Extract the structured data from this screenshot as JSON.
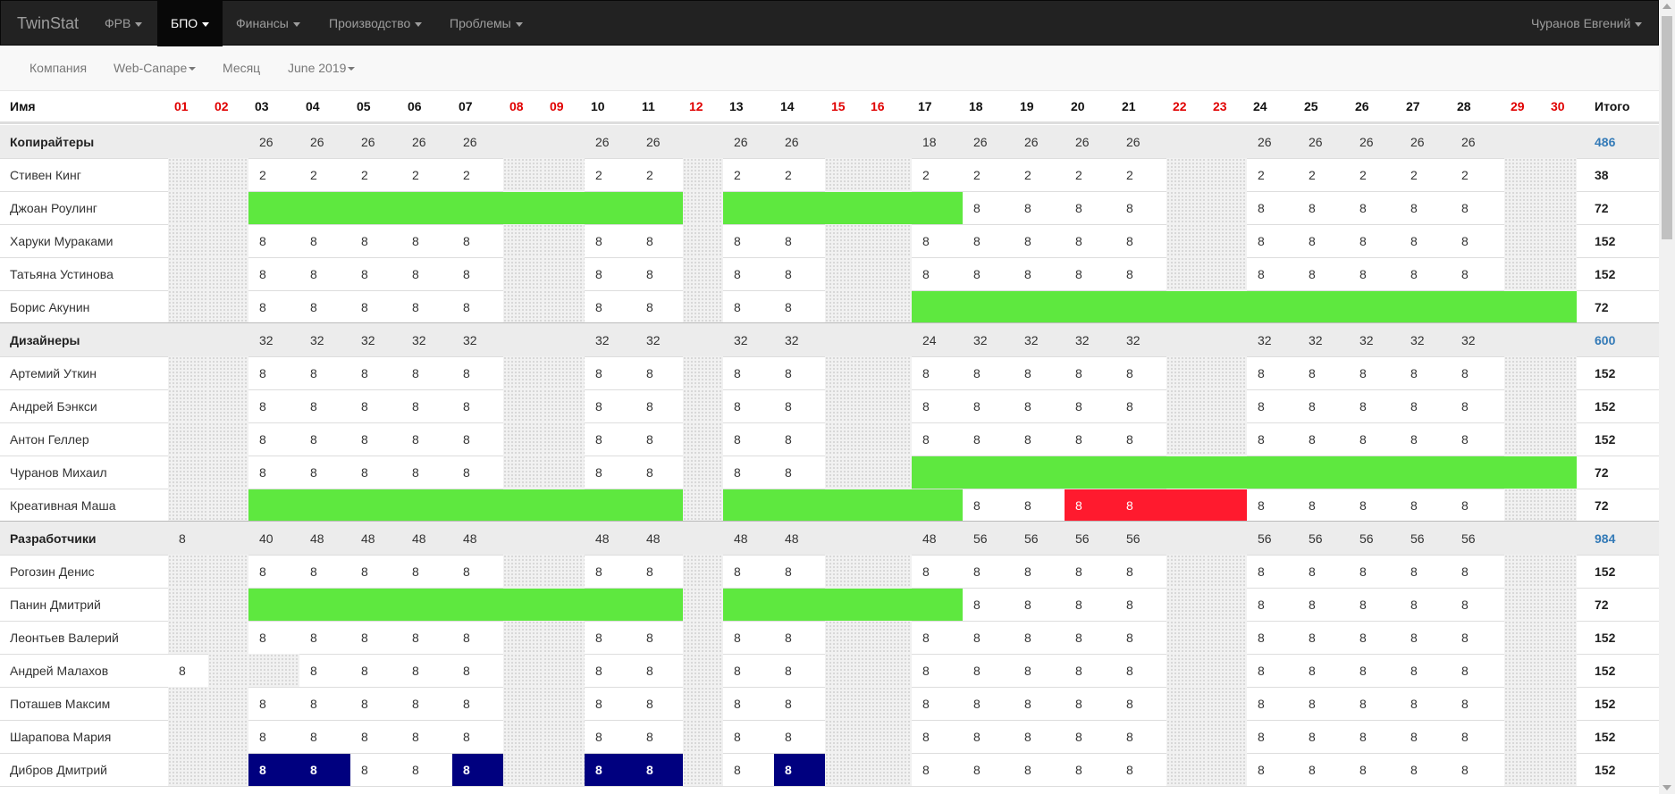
{
  "navbar": {
    "brand": "TwinStat",
    "items": [
      {
        "label": "ФРВ",
        "active": false
      },
      {
        "label": "БПО",
        "active": true
      },
      {
        "label": "Финансы",
        "active": false
      },
      {
        "label": "Производство",
        "active": false
      },
      {
        "label": "Проблемы",
        "active": false
      }
    ],
    "user": "Чуранов Евгений"
  },
  "subnav": {
    "company": "Компания",
    "project": "Web-Canape",
    "period": "Месяц",
    "month": "June 2019"
  },
  "colors": {
    "vacation": "#5ee83f",
    "absent": "#ff1a2e",
    "overtime": "#00007f",
    "weekend_text": "#e00000",
    "total_link": "#337ab7"
  },
  "table": {
    "name_header": "Имя",
    "total_header": "Итого",
    "days": [
      "01",
      "02",
      "03",
      "04",
      "05",
      "06",
      "07",
      "08",
      "09",
      "10",
      "11",
      "12",
      "13",
      "14",
      "15",
      "16",
      "17",
      "18",
      "19",
      "20",
      "21",
      "22",
      "23",
      "24",
      "25",
      "26",
      "27",
      "28",
      "29",
      "30"
    ],
    "weekends": [
      "01",
      "02",
      "08",
      "09",
      "12",
      "15",
      "16",
      "22",
      "23",
      "29",
      "30"
    ],
    "rows": [
      {
        "name": "Копирайтеры",
        "group": true,
        "total": "486",
        "cells": {
          "03": "26",
          "04": "26",
          "05": "26",
          "06": "26",
          "07": "26",
          "10": "26",
          "11": "26",
          "13": "26",
          "14": "26",
          "17": "18",
          "18": "26",
          "19": "26",
          "20": "26",
          "21": "26",
          "24": "26",
          "25": "26",
          "26": "26",
          "27": "26",
          "28": "26"
        }
      },
      {
        "name": "Стивен Кинг",
        "total": "38",
        "cells": {
          "03": "2",
          "04": "2",
          "05": "2",
          "06": "2",
          "07": "2",
          "10": "2",
          "11": "2",
          "13": "2",
          "14": "2",
          "17": "2",
          "18": "2",
          "19": "2",
          "20": "2",
          "21": "2",
          "24": "2",
          "25": "2",
          "26": "2",
          "27": "2",
          "28": "2"
        }
      },
      {
        "name": "Джоан Роулинг",
        "total": "72",
        "vacation": [
          [
            "03",
            "11"
          ],
          [
            "13",
            "17"
          ]
        ],
        "cells": {
          "18": "8",
          "19": "8",
          "20": "8",
          "21": "8",
          "24": "8",
          "25": "8",
          "26": "8",
          "27": "8",
          "28": "8"
        }
      },
      {
        "name": "Харуки Мураками",
        "total": "152",
        "cells": {
          "03": "8",
          "04": "8",
          "05": "8",
          "06": "8",
          "07": "8",
          "10": "8",
          "11": "8",
          "13": "8",
          "14": "8",
          "17": "8",
          "18": "8",
          "19": "8",
          "20": "8",
          "21": "8",
          "24": "8",
          "25": "8",
          "26": "8",
          "27": "8",
          "28": "8"
        }
      },
      {
        "name": "Татьяна Устинова",
        "total": "152",
        "cells": {
          "03": "8",
          "04": "8",
          "05": "8",
          "06": "8",
          "07": "8",
          "10": "8",
          "11": "8",
          "13": "8",
          "14": "8",
          "17": "8",
          "18": "8",
          "19": "8",
          "20": "8",
          "21": "8",
          "24": "8",
          "25": "8",
          "26": "8",
          "27": "8",
          "28": "8"
        }
      },
      {
        "name": "Борис Акунин",
        "total": "72",
        "vacation": [
          [
            "17",
            "30"
          ]
        ],
        "cells": {
          "03": "8",
          "04": "8",
          "05": "8",
          "06": "8",
          "07": "8",
          "10": "8",
          "11": "8",
          "13": "8",
          "14": "8"
        }
      },
      {
        "name": "Дизайнеры",
        "group": true,
        "total": "600",
        "cells": {
          "03": "32",
          "04": "32",
          "05": "32",
          "06": "32",
          "07": "32",
          "10": "32",
          "11": "32",
          "13": "32",
          "14": "32",
          "17": "24",
          "18": "32",
          "19": "32",
          "20": "32",
          "21": "32",
          "24": "32",
          "25": "32",
          "26": "32",
          "27": "32",
          "28": "32"
        }
      },
      {
        "name": "Артемий Уткин",
        "total": "152",
        "cells": {
          "03": "8",
          "04": "8",
          "05": "8",
          "06": "8",
          "07": "8",
          "10": "8",
          "11": "8",
          "13": "8",
          "14": "8",
          "17": "8",
          "18": "8",
          "19": "8",
          "20": "8",
          "21": "8",
          "24": "8",
          "25": "8",
          "26": "8",
          "27": "8",
          "28": "8"
        }
      },
      {
        "name": "Андрей Бэнкси",
        "total": "152",
        "cells": {
          "03": "8",
          "04": "8",
          "05": "8",
          "06": "8",
          "07": "8",
          "10": "8",
          "11": "8",
          "13": "8",
          "14": "8",
          "17": "8",
          "18": "8",
          "19": "8",
          "20": "8",
          "21": "8",
          "24": "8",
          "25": "8",
          "26": "8",
          "27": "8",
          "28": "8"
        }
      },
      {
        "name": "Антон Геллер",
        "total": "152",
        "cells": {
          "03": "8",
          "04": "8",
          "05": "8",
          "06": "8",
          "07": "8",
          "10": "8",
          "11": "8",
          "13": "8",
          "14": "8",
          "17": "8",
          "18": "8",
          "19": "8",
          "20": "8",
          "21": "8",
          "24": "8",
          "25": "8",
          "26": "8",
          "27": "8",
          "28": "8"
        }
      },
      {
        "name": "Чуранов Михаил",
        "total": "72",
        "vacation": [
          [
            "17",
            "30"
          ]
        ],
        "cells": {
          "03": "8",
          "04": "8",
          "05": "8",
          "06": "8",
          "07": "8",
          "10": "8",
          "11": "8",
          "13": "8",
          "14": "8"
        }
      },
      {
        "name": "Креативная Маша",
        "total": "72",
        "vacation": [
          [
            "03",
            "11"
          ],
          [
            "13",
            "17"
          ]
        ],
        "absent": [
          [
            "20",
            "23"
          ]
        ],
        "cells": {
          "18": "8",
          "19": "8",
          "20": "8",
          "21": "8",
          "24": "8",
          "25": "8",
          "26": "8",
          "27": "8",
          "28": "8"
        }
      },
      {
        "name": "Разработчики",
        "group": true,
        "total": "984",
        "cells": {
          "01": "8",
          "03": "40",
          "04": "48",
          "05": "48",
          "06": "48",
          "07": "48",
          "10": "48",
          "11": "48",
          "13": "48",
          "14": "48",
          "17": "48",
          "18": "56",
          "19": "56",
          "20": "56",
          "21": "56",
          "24": "56",
          "25": "56",
          "26": "56",
          "27": "56",
          "28": "56"
        }
      },
      {
        "name": "Рогозин Денис",
        "total": "152",
        "cells": {
          "03": "8",
          "04": "8",
          "05": "8",
          "06": "8",
          "07": "8",
          "10": "8",
          "11": "8",
          "13": "8",
          "14": "8",
          "17": "8",
          "18": "8",
          "19": "8",
          "20": "8",
          "21": "8",
          "24": "8",
          "25": "8",
          "26": "8",
          "27": "8",
          "28": "8"
        }
      },
      {
        "name": "Панин Дмитрий",
        "total": "72",
        "vacation": [
          [
            "03",
            "11"
          ],
          [
            "13",
            "17"
          ]
        ],
        "cells": {
          "18": "8",
          "19": "8",
          "20": "8",
          "21": "8",
          "24": "8",
          "25": "8",
          "26": "8",
          "27": "8",
          "28": "8"
        }
      },
      {
        "name": "Леонтьев Валерий",
        "total": "152",
        "cells": {
          "03": "8",
          "04": "8",
          "05": "8",
          "06": "8",
          "07": "8",
          "10": "8",
          "11": "8",
          "13": "8",
          "14": "8",
          "17": "8",
          "18": "8",
          "19": "8",
          "20": "8",
          "21": "8",
          "24": "8",
          "25": "8",
          "26": "8",
          "27": "8",
          "28": "8"
        }
      },
      {
        "name": "Андрей Малахов",
        "total": "152",
        "worked_weekend": [
          "01"
        ],
        "dotted_workday": [
          "03"
        ],
        "cells": {
          "01": "8",
          "04": "8",
          "05": "8",
          "06": "8",
          "07": "8",
          "10": "8",
          "11": "8",
          "13": "8",
          "14": "8",
          "17": "8",
          "18": "8",
          "19": "8",
          "20": "8",
          "21": "8",
          "24": "8",
          "25": "8",
          "26": "8",
          "27": "8",
          "28": "8"
        }
      },
      {
        "name": "Поташев Максим",
        "total": "152",
        "cells": {
          "03": "8",
          "04": "8",
          "05": "8",
          "06": "8",
          "07": "8",
          "10": "8",
          "11": "8",
          "13": "8",
          "14": "8",
          "17": "8",
          "18": "8",
          "19": "8",
          "20": "8",
          "21": "8",
          "24": "8",
          "25": "8",
          "26": "8",
          "27": "8",
          "28": "8"
        }
      },
      {
        "name": "Шарапова Мария",
        "total": "152",
        "cells": {
          "03": "8",
          "04": "8",
          "05": "8",
          "06": "8",
          "07": "8",
          "10": "8",
          "11": "8",
          "13": "8",
          "14": "8",
          "17": "8",
          "18": "8",
          "19": "8",
          "20": "8",
          "21": "8",
          "24": "8",
          "25": "8",
          "26": "8",
          "27": "8",
          "28": "8"
        }
      },
      {
        "name": "Дибров Дмитрий",
        "total": "152",
        "overtime": [
          [
            "03",
            "04"
          ],
          [
            "07",
            "07"
          ],
          [
            "10",
            "11"
          ],
          [
            "14",
            "14"
          ]
        ],
        "cells": {
          "03": "8",
          "04": "8",
          "05": "8",
          "06": "8",
          "07": "8",
          "10": "8",
          "11": "8",
          "13": "8",
          "14": "8",
          "17": "8",
          "18": "8",
          "19": "8",
          "20": "8",
          "21": "8",
          "24": "8",
          "25": "8",
          "26": "8",
          "27": "8",
          "28": "8"
        }
      }
    ]
  }
}
